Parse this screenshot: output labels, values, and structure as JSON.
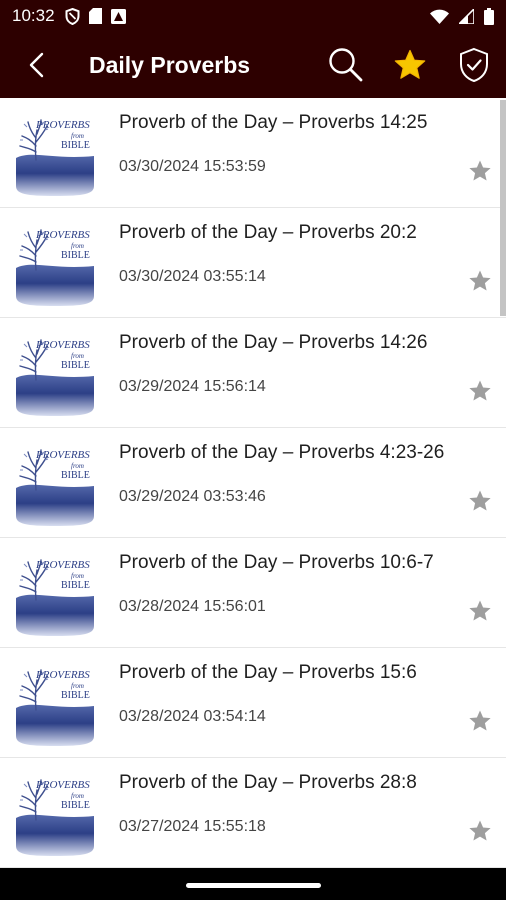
{
  "status_bar": {
    "time": "10:32",
    "left_icons": [
      "shield-icon",
      "sim-card-icon",
      "app-notification-icon"
    ],
    "right_icons": [
      "wifi-icon",
      "signal-icon",
      "battery-icon"
    ]
  },
  "app_bar": {
    "title": "Daily Proverbs",
    "background_color": "#2d0000",
    "actions": [
      "back-icon",
      "search-icon",
      "star-icon",
      "shield-check-icon"
    ],
    "star_color": "#f7c600"
  },
  "thumbnail": {
    "line1": "PROVERBS",
    "line2": "from",
    "line3": "BIBLE"
  },
  "items": [
    {
      "title": "Proverb of the Day – Proverbs 14:25",
      "date": "03/30/2024 15:53:59"
    },
    {
      "title": "Proverb of the Day – Proverbs 20:2",
      "date": "03/30/2024 03:55:14"
    },
    {
      "title": "Proverb of the Day – Proverbs 14:26",
      "date": "03/29/2024 15:56:14"
    },
    {
      "title": "Proverb of the Day – Proverbs 4:23-26",
      "date": "03/29/2024 03:53:46"
    },
    {
      "title": "Proverb of the Day – Proverbs 10:6-7",
      "date": "03/28/2024 15:56:01"
    },
    {
      "title": "Proverb of the Day – Proverbs 15:6",
      "date": "03/28/2024 03:54:14"
    },
    {
      "title": "Proverb of the Day – Proverbs 28:8",
      "date": "03/27/2024 15:55:18"
    }
  ]
}
